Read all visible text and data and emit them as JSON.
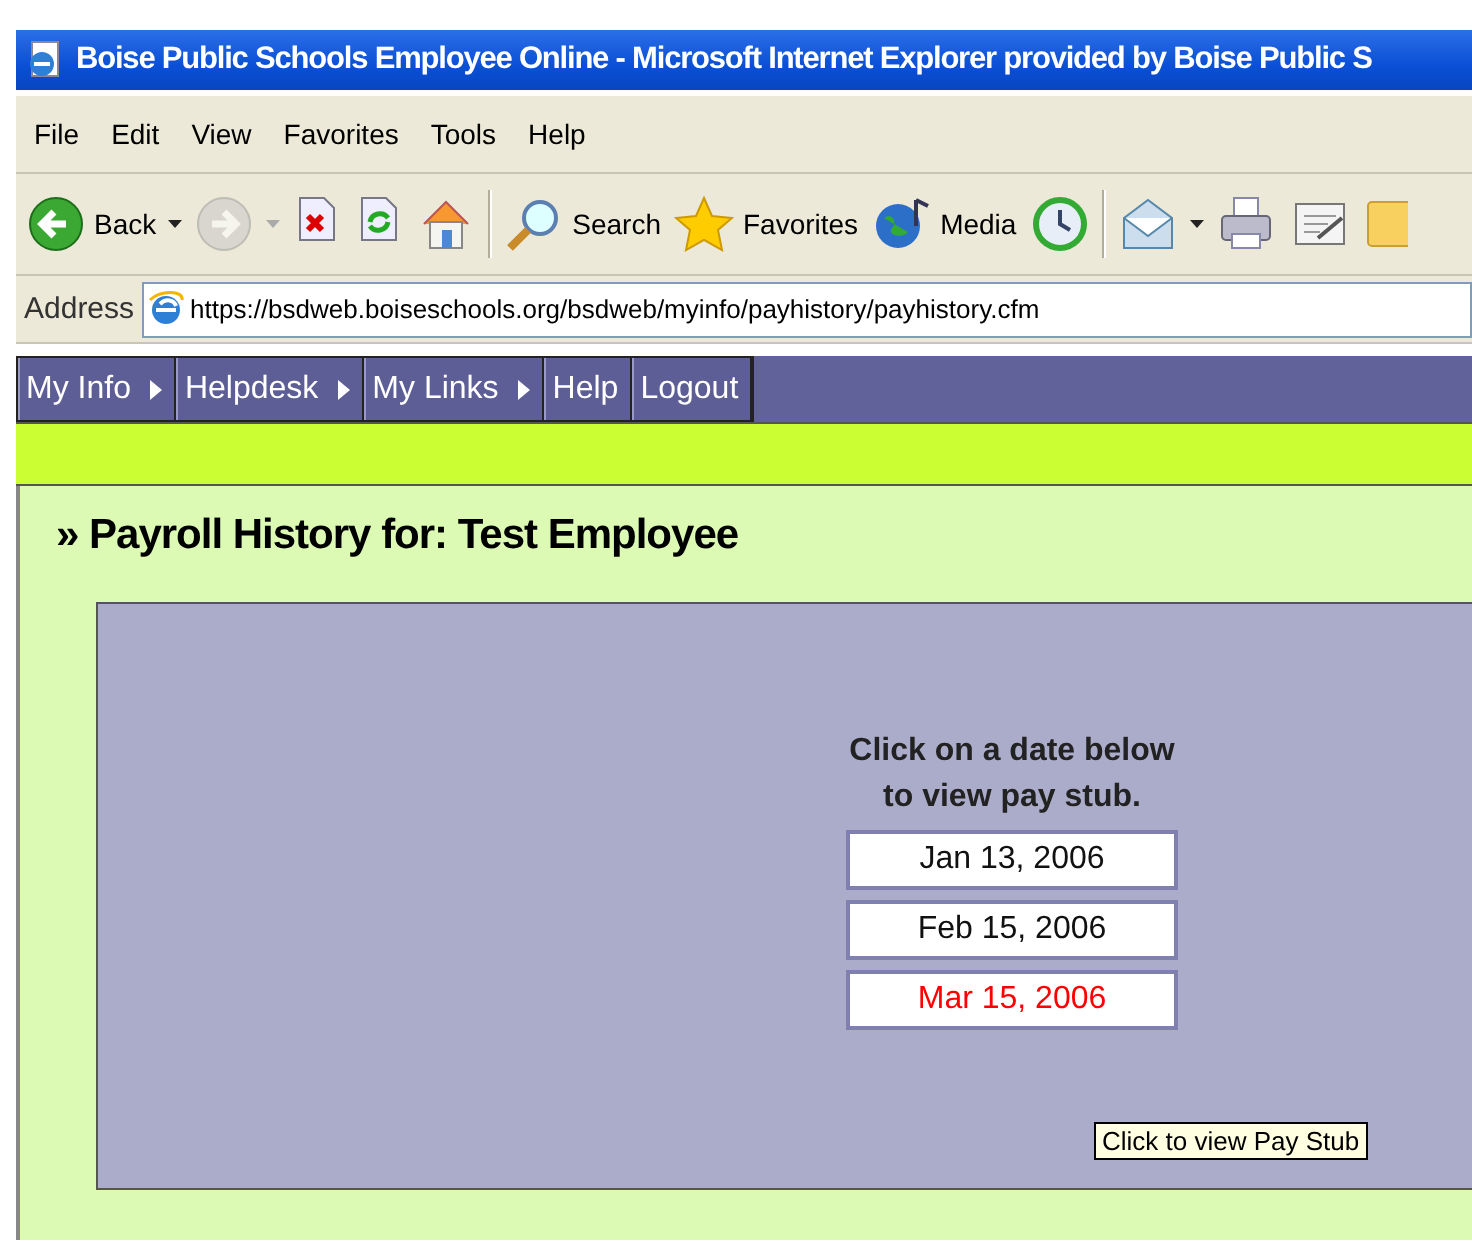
{
  "window": {
    "title": "Boise Public Schools Employee Online - Microsoft Internet Explorer provided by Boise Public S"
  },
  "menu_bar": [
    "File",
    "Edit",
    "View",
    "Favorites",
    "Tools",
    "Help"
  ],
  "toolbar": [
    {
      "kind": "back",
      "label": "Back",
      "dropdown": true,
      "disabled": false
    },
    {
      "kind": "forward",
      "dropdown": true,
      "disabled": true
    },
    {
      "kind": "stop",
      "disabled": false
    },
    {
      "kind": "refresh",
      "disabled": false
    },
    {
      "kind": "home",
      "disabled": false
    },
    {
      "kind": "separator"
    },
    {
      "kind": "search",
      "label": "Search",
      "disabled": false
    },
    {
      "kind": "favorites",
      "label": "Favorites",
      "disabled": false
    },
    {
      "kind": "media",
      "label": "Media",
      "disabled": false
    },
    {
      "kind": "history",
      "disabled": false
    },
    {
      "kind": "separator"
    },
    {
      "kind": "mail",
      "dropdown": true,
      "disabled": false
    },
    {
      "kind": "print",
      "disabled": false
    },
    {
      "kind": "edit",
      "disabled": false
    },
    {
      "kind": "folder",
      "disabled": false
    }
  ],
  "address_bar": {
    "label": "Address",
    "url": "https://bsdweb.boiseschools.org/bsdweb/myinfo/payhistory/payhistory.cfm"
  },
  "nav": [
    {
      "label": "My Info",
      "submenu": true
    },
    {
      "label": "Helpdesk",
      "submenu": true
    },
    {
      "label": "My Links",
      "submenu": true
    },
    {
      "label": "Help",
      "submenu": false
    },
    {
      "label": "Logout",
      "submenu": false
    }
  ],
  "page": {
    "heading": "» Payroll History for: Test Employee",
    "instructions": [
      "Click on a date below",
      "to view pay stub."
    ],
    "dates": [
      {
        "label": "Jan 13, 2006",
        "hovered": false
      },
      {
        "label": "Feb 15, 2006",
        "hovered": false
      },
      {
        "label": "Mar 15, 2006",
        "hovered": true
      }
    ],
    "tooltip": "Click to view Pay Stub"
  }
}
